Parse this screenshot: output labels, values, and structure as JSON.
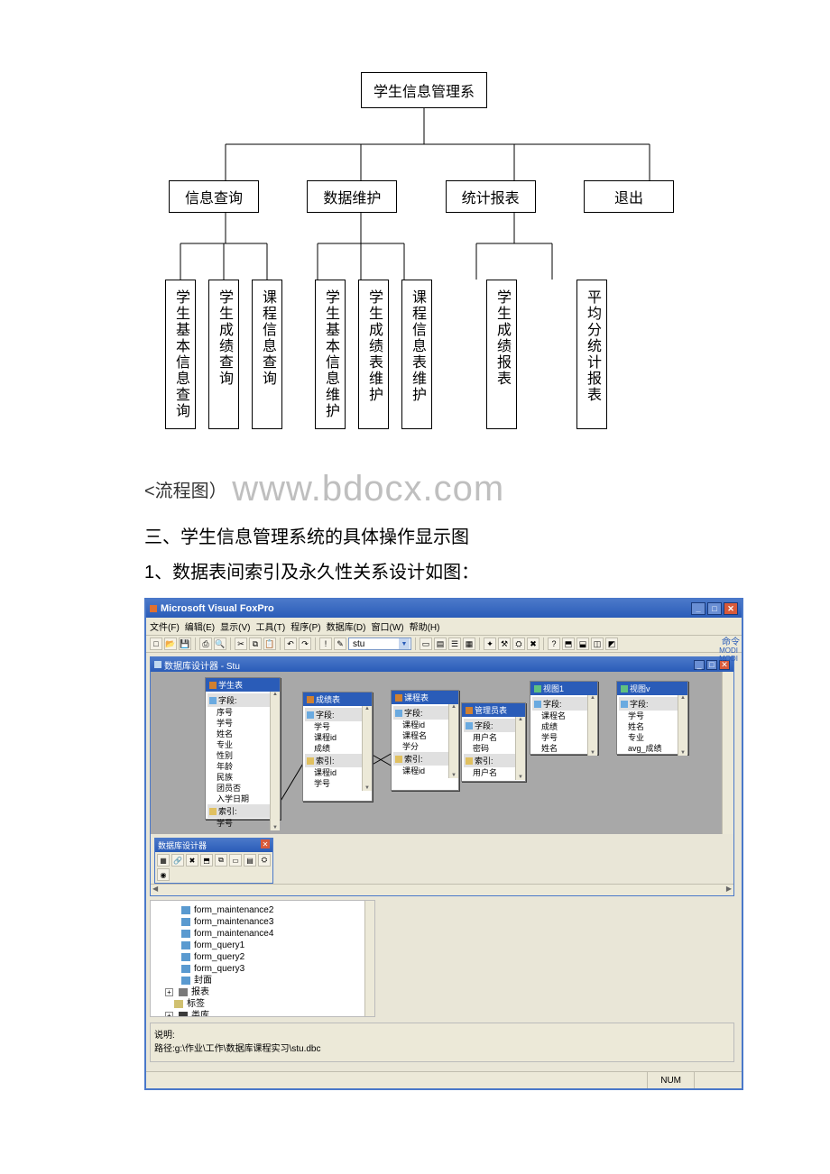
{
  "chart_data": {
    "type": "tree",
    "root": "学生信息管理系",
    "children": [
      {
        "label": "信息查询",
        "children": [
          "学生基本信息查询",
          "学生成绩查询",
          "课程信息查询"
        ]
      },
      {
        "label": "数据维护",
        "children": [
          "学生基本信息维护",
          "学生成绩表维护",
          "课程信息表维护"
        ]
      },
      {
        "label": "统计报表",
        "children": [
          "学生成绩报表",
          "平均分统计报表"
        ]
      },
      {
        "label": "退出",
        "children": []
      }
    ]
  },
  "orgchart": {
    "root": "学生信息管理系",
    "level2": [
      "信息查询",
      "数据维护",
      "统计报表",
      "退出"
    ],
    "level3": [
      "学生基本信息查询",
      "学生成绩查询",
      "课程信息查询",
      "学生基本信息维护",
      "学生成绩表维护",
      "课程信息表维护",
      "学生成绩报表",
      "平均分统计报表"
    ]
  },
  "body": {
    "caption_prefix": "<流程图）",
    "watermark": "www.bdocx.com",
    "heading3": "三、学生信息管理系统的具体操作显示图",
    "heading4": "1、数据表间索引及永久性关系设计如图："
  },
  "vfp": {
    "app_title": "Microsoft Visual FoxPro",
    "menu": [
      "文件(F)",
      "编辑(E)",
      "显示(V)",
      "工具(T)",
      "程序(P)",
      "数据库(D)",
      "窗口(W)",
      "帮助(H)"
    ],
    "combo_value": "stu",
    "cmd_label": "命令",
    "side_tags": [
      "MODI",
      "MODI"
    ],
    "designer_title": "数据库设计器 - Stu",
    "tables": {
      "t1": {
        "title": "学生表",
        "sections": {
          "fields": "字段:",
          "index": "索引:"
        },
        "fields": [
          "序号",
          "学号",
          "姓名",
          "专业",
          "性别",
          "年龄",
          "民族",
          "团员否",
          "入学日期"
        ],
        "index_items": [
          "学号"
        ]
      },
      "t2": {
        "title": "成绩表",
        "sections": {
          "fields": "字段:",
          "index": "索引:"
        },
        "fields": [
          "学号",
          "课程id",
          "成绩"
        ],
        "index_items": [
          "课程id",
          "学号"
        ]
      },
      "t3": {
        "title": "课程表",
        "sections": {
          "fields": "字段:",
          "index": "索引:"
        },
        "fields": [
          "课程id",
          "课程名",
          "学分"
        ],
        "index_items": [
          "课程id"
        ]
      },
      "t4": {
        "title": "管理员表",
        "sections": {
          "fields": "字段:",
          "index": "索引:"
        },
        "fields": [
          "用户名",
          "密码"
        ],
        "index_items": [
          "用户名"
        ]
      },
      "t5": {
        "title": "视图1",
        "sections": {
          "fields": "字段:"
        },
        "fields": [
          "课程名",
          "成绩",
          "学号",
          "姓名"
        ]
      },
      "t6": {
        "title": "视图v",
        "sections": {
          "fields": "字段:"
        },
        "fields": [
          "学号",
          "姓名",
          "专业",
          "avg_成绩"
        ]
      }
    },
    "toolbox_title": "数据库设计器",
    "project": {
      "items": [
        {
          "icon": "pi-form",
          "label": "form_maintenance2"
        },
        {
          "icon": "pi-form",
          "label": "form_maintenance3"
        },
        {
          "icon": "pi-form",
          "label": "form_maintenance4"
        },
        {
          "icon": "pi-form",
          "label": "form_query1"
        },
        {
          "icon": "pi-form",
          "label": "form_query2"
        },
        {
          "icon": "pi-form",
          "label": "form_query3"
        },
        {
          "icon": "pi-form",
          "label": "封面"
        }
      ],
      "groups": [
        {
          "icon": "pi-report",
          "label": "报表"
        },
        {
          "icon": "pi-label",
          "label": "标签"
        },
        {
          "icon": "pi-class",
          "label": "类库"
        }
      ]
    },
    "desc_label": "说明:",
    "desc_path": "路径:g:\\作业\\工作\\数据库课程实习\\stu.dbc",
    "status": {
      "num": "NUM"
    }
  }
}
